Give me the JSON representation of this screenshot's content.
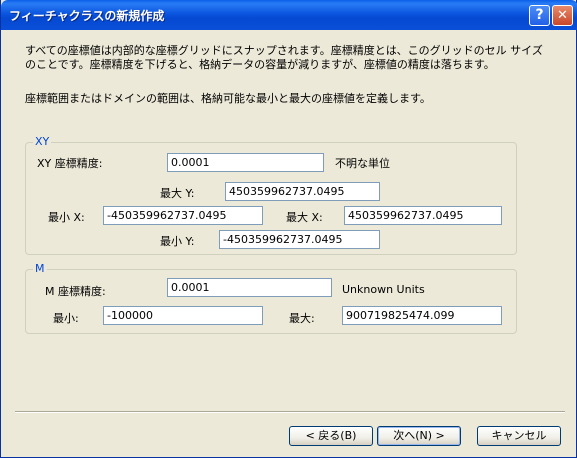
{
  "window": {
    "title": "フィーチャクラスの新規作成",
    "help_glyph": "?",
    "close_glyph": "✕"
  },
  "description": {
    "line1": "すべての座標値は内部的な座標グリッドにスナップされます。座標精度とは、このグリッドのセル サイズ",
    "line2": "のことです。座標精度を下げると、格納データの容量が減りますが、座標値の精度は落ちます。",
    "line3": "座標範囲またはドメインの範囲は、格納可能な最小と最大の座標値を定義します。"
  },
  "xy_group": {
    "title": "XY",
    "precision_label": "XY 座標精度:",
    "precision_value": "0.0001",
    "units": "不明な単位",
    "max_y_label": "最大 Y:",
    "max_y_value": "450359962737.0495",
    "min_x_label": "最小 X:",
    "min_x_value": "-450359962737.0495",
    "max_x_label": "最大 X:",
    "max_x_value": "450359962737.0495",
    "min_y_label": "最小 Y:",
    "min_y_value": "-450359962737.0495"
  },
  "m_group": {
    "title": "M",
    "precision_label": "M 座標精度:",
    "precision_value": "0.0001",
    "units": "Unknown Units",
    "min_label": "最小:",
    "min_value": "-100000",
    "max_label": "最大:",
    "max_value": "900719825474.099"
  },
  "buttons": {
    "back": "< 戻る(B)",
    "next": "次へ(N) >",
    "cancel": "キャンセル"
  }
}
